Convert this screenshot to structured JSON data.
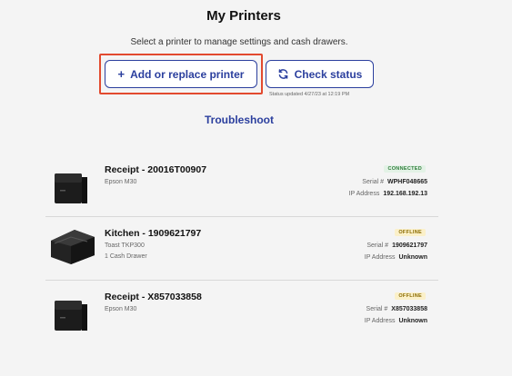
{
  "header": {
    "title": "My Printers",
    "subtitle": "Select a printer to manage settings and cash drawers."
  },
  "actions": {
    "add_label": "Add or replace printer",
    "add_icon": "plus-icon",
    "check_label": "Check status",
    "check_icon": "refresh-icon",
    "status_updated": "Status updated 4/27/23 at 12:19 PM",
    "troubleshoot_label": "Troubleshoot"
  },
  "colors": {
    "accent": "#2b3f9e",
    "highlight": "#e24a2f",
    "connected": "#2e7d3a",
    "offline": "#8a6a00"
  },
  "printers": [
    {
      "name": "Receipt - 20016T00907",
      "model": "Epson M30",
      "drawer": "",
      "status": "CONNECTED",
      "serial_label": "Serial #",
      "serial": "WPHF048665",
      "ip_label": "IP Address",
      "ip": "192.168.192.13"
    },
    {
      "name": "Kitchen - 1909621797",
      "model": "Toast TKP300",
      "drawer": "1 Cash Drawer",
      "status": "OFFLINE",
      "serial_label": "Serial #",
      "serial": "1909621797",
      "ip_label": "IP Address",
      "ip": "Unknown"
    },
    {
      "name": "Receipt - X857033858",
      "model": "Epson M30",
      "drawer": "",
      "status": "OFFLINE",
      "serial_label": "Serial #",
      "serial": "X857033858",
      "ip_label": "IP Address",
      "ip": "Unknown"
    }
  ]
}
